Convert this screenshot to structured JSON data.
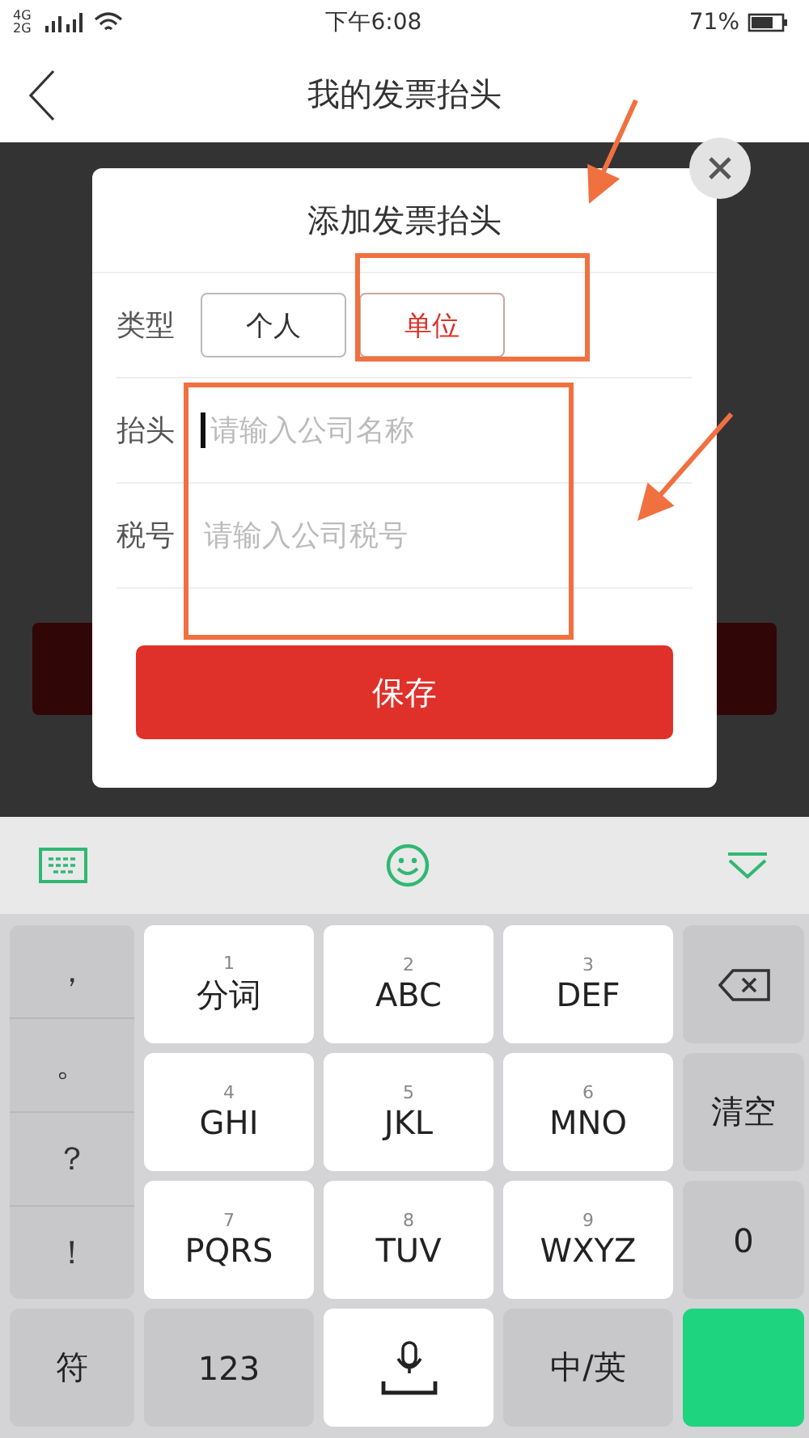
{
  "status_bar": {
    "network": "4G 2G",
    "time": "下午6:08",
    "battery": "71%"
  },
  "nav": {
    "title": "我的发票抬头"
  },
  "dialog": {
    "title": "添加发票抬头",
    "type_row": {
      "label": "类型",
      "options": [
        {
          "label": "个人",
          "selected": false
        },
        {
          "label": "单位",
          "selected": true
        }
      ]
    },
    "fields": [
      {
        "label": "抬头",
        "placeholder": "请输入公司名称",
        "focused": true
      },
      {
        "label": "税号",
        "placeholder": "请输入公司税号",
        "focused": false
      }
    ],
    "save_button": "保存"
  },
  "annotations": [
    {
      "kind": "arrow"
    },
    {
      "kind": "frame"
    },
    {
      "kind": "frame"
    },
    {
      "kind": "arrow"
    }
  ],
  "keyboard": {
    "symbols": [
      "，",
      "。",
      "？",
      "！"
    ],
    "keys": [
      {
        "number": "1",
        "label": "分词"
      },
      {
        "number": "2",
        "label": "ABC"
      },
      {
        "number": "3",
        "label": "DEF"
      },
      {
        "number": "4",
        "label": "GHI"
      },
      {
        "number": "5",
        "label": "JKL"
      },
      {
        "number": "6",
        "label": "MNO"
      },
      {
        "number": "7",
        "label": "PQRS"
      },
      {
        "number": "8",
        "label": "TUV"
      },
      {
        "number": "9",
        "label": "WXYZ"
      }
    ],
    "side": [
      {
        "kind": "delete"
      },
      {
        "kind": "text",
        "label": "清空"
      },
      {
        "kind": "text",
        "label": "0"
      }
    ],
    "bottom": [
      {
        "kind": "text",
        "label": "符"
      },
      {
        "kind": "text",
        "label": "123"
      },
      {
        "kind": "voice"
      },
      {
        "kind": "text",
        "label": "中/英"
      },
      {
        "kind": "confirm"
      }
    ]
  }
}
